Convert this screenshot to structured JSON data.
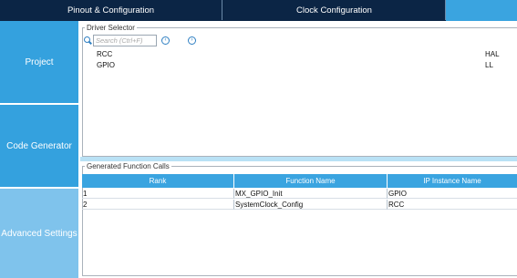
{
  "tabs": {
    "pinout": "Pinout & Configuration",
    "clock": "Clock Configuration",
    "active": ""
  },
  "sidebar": {
    "items": [
      {
        "label": "Project"
      },
      {
        "label": "Code Generator"
      },
      {
        "label": "Advanced Settings"
      }
    ]
  },
  "driver_selector": {
    "title": "Driver Selector",
    "search_placeholder": "Search (Ctrl+F)",
    "rows": [
      {
        "name": "RCC",
        "value": "HAL"
      },
      {
        "name": "GPIO",
        "value": "LL"
      }
    ]
  },
  "function_calls": {
    "title": "Generated Function Calls",
    "columns": [
      "Rank",
      "Function Name",
      "IP Instance Name"
    ],
    "rows": [
      {
        "rank": "1",
        "function": "MX_GPIO_Init",
        "ip": "GPIO"
      },
      {
        "rank": "2",
        "function": "SystemClock_Config",
        "ip": "RCC"
      }
    ]
  },
  "colors": {
    "tab_bar": "#0b2545",
    "accent": "#3aa4e0",
    "sidebar": "#34a1de",
    "sidebar_selected": "#7fc3ec"
  },
  "icons": [
    "search-icon",
    "arrow-left-circle-icon",
    "arrow-right-circle-icon"
  ]
}
